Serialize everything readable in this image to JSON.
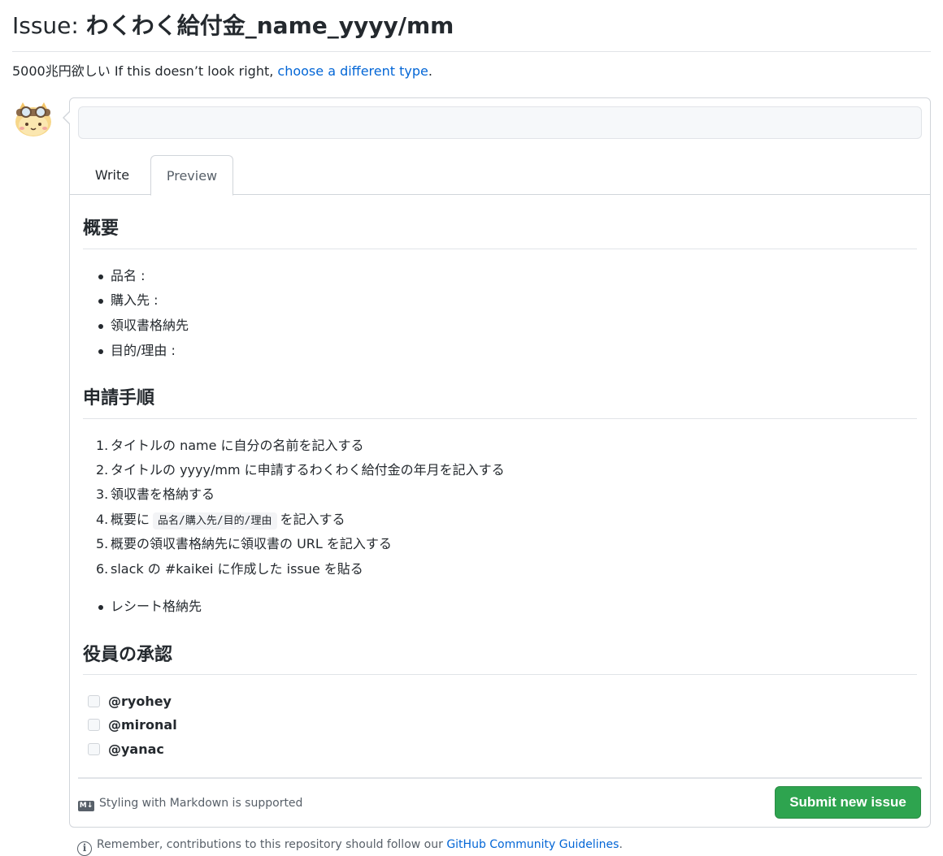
{
  "header": {
    "prefix": "Issue:",
    "template_name": "わくわく給付金_name_yyyy/mm",
    "description": "5000兆円欲しい",
    "type_hint": "If this doesn’t look right,",
    "type_link": "choose a different type",
    "type_hint_end": "."
  },
  "composer": {
    "title_value": "",
    "title_placeholder": "",
    "tabs": [
      {
        "label": "Write"
      },
      {
        "label": "Preview"
      }
    ],
    "active_tab": "Preview"
  },
  "preview": {
    "section1": {
      "heading": "概要",
      "items": [
        {
          "text": "品名 :",
          "is_link": false
        },
        {
          "text": "購入先 :",
          "is_link": false
        },
        {
          "text": "領収書格納先",
          "is_link": true
        },
        {
          "text": "目的/理由 :",
          "is_link": false
        }
      ]
    },
    "section2": {
      "heading": "申請手順",
      "steps": [
        {
          "num": "1.",
          "text": "タイトルの name に自分の名前を記入する"
        },
        {
          "num": "2.",
          "text": "タイトルの yyyy/mm に申請するわくわく給付金の年月を記入する"
        },
        {
          "num": "3.",
          "text": "領収書を格納する"
        },
        {
          "num": "4.",
          "pre": "概要に",
          "code": "品名/購入先/目的/理由",
          "post": "を記入する"
        },
        {
          "num": "5.",
          "text": "概要の領収書格納先に領収書の URL を記入する"
        },
        {
          "num": "6.",
          "text": "slack の #kaikei に作成した issue を貼る"
        }
      ],
      "link": "レシート格納先"
    },
    "section3": {
      "heading": "役員の承認",
      "approvers": [
        "@ryohey",
        "@mironal",
        "@yanac"
      ]
    }
  },
  "footer": {
    "markdown_icon": "M↓",
    "markdown_note": "Styling with Markdown is supported",
    "submit_label": "Submit new issue"
  },
  "guidelines": {
    "text": "Remember, contributions to this repository should follow our",
    "link": "GitHub Community Guidelines",
    "end": "."
  },
  "colors": {
    "accent": "#0366d6",
    "submit": "#2ea44f",
    "text": "#24292e",
    "muted": "#586069",
    "border": "#d1d5da"
  }
}
